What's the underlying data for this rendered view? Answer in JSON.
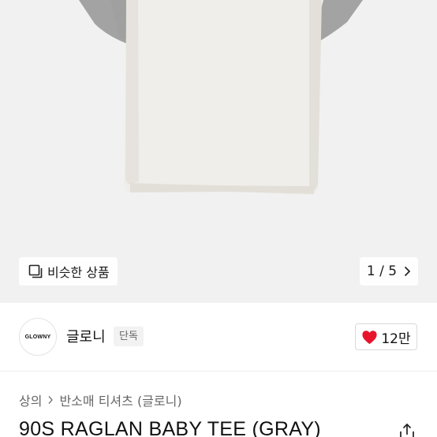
{
  "gallery": {
    "similar_label": "비슷한 상품",
    "pager": "1 / 5",
    "image_subject": "white t-shirt with gray raglan sleeves"
  },
  "brand": {
    "logo_text": "GLOWNY",
    "name": "글로니",
    "badge": "단독",
    "like_count": "12만",
    "heart_color": "#e8142c"
  },
  "breadcrumb": {
    "items": [
      "상의",
      "반소매 티셔츠 (글로니)"
    ]
  },
  "product": {
    "title": "90S RAGLAN BABY TEE (GRAY)"
  },
  "icons": [
    "similar-products-icon",
    "chevron-right-icon",
    "heart-icon",
    "share-icon"
  ]
}
